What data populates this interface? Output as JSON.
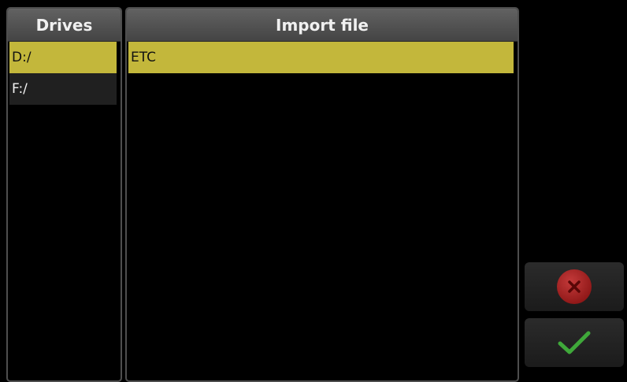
{
  "drives": {
    "header": "Drives",
    "items": [
      {
        "label": "D:/",
        "selected": true
      },
      {
        "label": "F:/",
        "selected": false
      }
    ]
  },
  "files": {
    "header": "Import file",
    "items": [
      {
        "label": "ETC",
        "selected": true
      }
    ]
  },
  "actions": {
    "cancel_icon": "cancel-x-icon",
    "confirm_icon": "checkmark-icon"
  },
  "colors": {
    "selection": "#c3b73b",
    "cancel": "#9a1414",
    "confirm": "#3fa83a"
  }
}
